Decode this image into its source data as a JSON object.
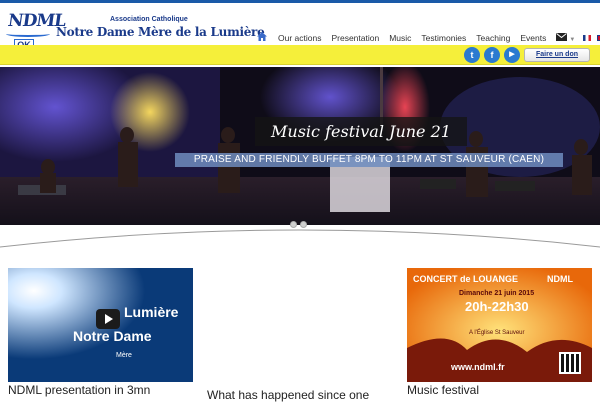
{
  "header": {
    "logo_text": "NDML",
    "logo_badge": "OK",
    "assoc_subtitle": "Association Catholique",
    "assoc_name": "Notre Dame Mère de la Lumière"
  },
  "nav": {
    "items": [
      {
        "label": "Our actions"
      },
      {
        "label": "Presentation"
      },
      {
        "label": "Music"
      },
      {
        "label": "Testimonies"
      },
      {
        "label": "Teaching"
      },
      {
        "label": "Events"
      }
    ]
  },
  "social": {
    "twitter": "t",
    "facebook": "f",
    "youtube": "▶",
    "donate_label": "Faire un don"
  },
  "hero": {
    "caption_title": "Music festival June 21",
    "caption_subtitle": "PRAISE AND FRIENDLY BUFFET 8PM TO 11PM AT ST SAUVEUR (CAEN)"
  },
  "cards": [
    {
      "title": "NDML presentation in 3mn",
      "thumb_words": [
        "Lumière",
        "Notre Dame",
        "Mère"
      ]
    },
    {
      "title": "What has happened since one"
    },
    {
      "title": "Music festival",
      "poster": {
        "headline": "CONCERT de LOUANGE",
        "org": "NDML",
        "date": "Dimanche 21 juin 2015",
        "time": "20h-22h30",
        "place": "A l'Église St Sauveur",
        "site": "www.ndml.fr"
      }
    }
  ],
  "colors": {
    "brand_blue": "#1a3a8a",
    "accent_yellow": "#f5ef3a",
    "social_blue": "#2b7ad0"
  }
}
